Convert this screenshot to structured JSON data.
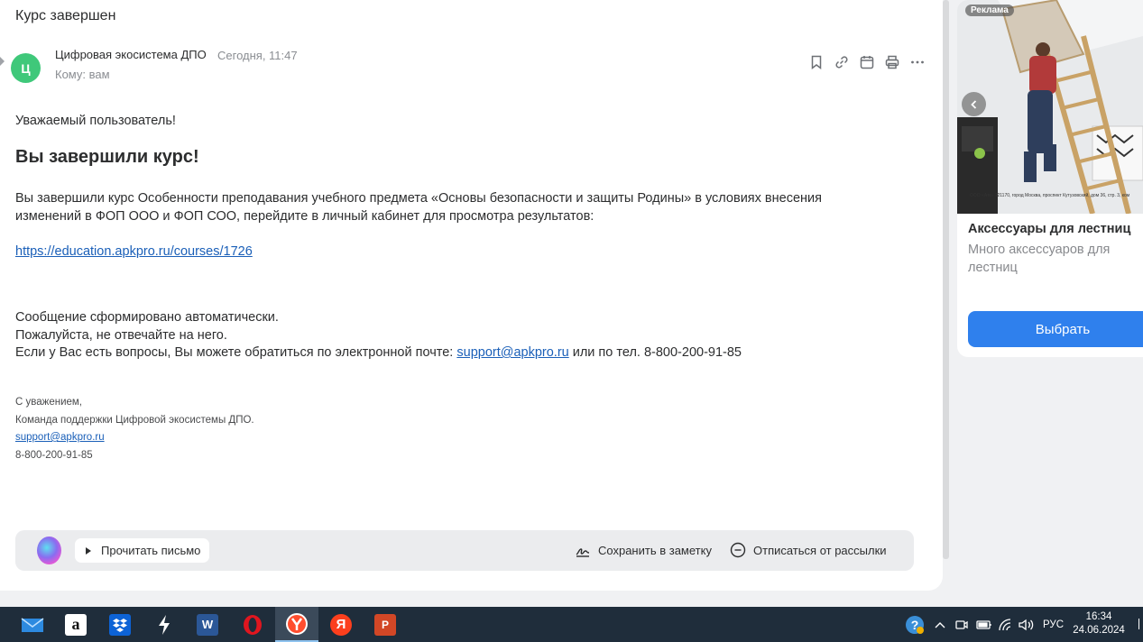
{
  "mail": {
    "subject": "Курс завершен",
    "avatar_letter": "Ц",
    "sender": "Цифровая экосистема ДПО",
    "date": "Сегодня, 11:47",
    "to_label": "Кому:",
    "to_value": "вам",
    "greeting": "Уважаемый пользователь!",
    "headline": "Вы завершили курс!",
    "paragraph": "Вы завершили курс Особенности преподавания учебного предмета «Основы безопасности и защиты Родины» в условиях внесения изменений в ФОП ООО и ФОП СОО, перейдите в личный кабинет для просмотра результатов:",
    "course_link": "https://education.apkpro.ru/courses/1726",
    "auto_line1": "Сообщение сформировано автоматически.",
    "auto_line2": "Пожалуйста, не отвечайте на него.",
    "auto_line3_prefix": "Если у Вас есть вопросы, Вы можете обратиться по электронной почте: ",
    "auto_line3_email": "support@apkpro.ru",
    "auto_line3_suffix": " или по тел. 8-800-200-91-85",
    "sign_line1": "С уважением,",
    "sign_line2": "Команда поддержки Цифровой экосистемы ДПО.",
    "sign_email": "support@apkpro.ru",
    "sign_phone": "8-800-200-91-85",
    "toolbar_icons": [
      "bookmark-icon",
      "link-icon",
      "calendar-icon",
      "print-icon",
      "more-icon"
    ]
  },
  "action_bar": {
    "read_label": "Прочитать письмо",
    "save_note_label": "Сохранить в заметку",
    "unsubscribe_label": "Отписаться от рассылки"
  },
  "ad": {
    "badge": "Реклама",
    "small_print": "ООО «Атк» 121170, город Москва, проспект Кутузовский, дом 36, стр. 3, ком",
    "title": "Аксессуары для лестниц",
    "description": "Много аксессуаров для лестниц",
    "button_label": "Выбрать",
    "accent_color": "#2f80ed"
  },
  "taskbar": {
    "apps": [
      "mail",
      "amazon",
      "dropbox",
      "bolt",
      "word",
      "opera",
      "yandex-browser",
      "yandex",
      "powerpoint"
    ],
    "active_app": "yandex-browser",
    "language": "РУС",
    "time": "16:34",
    "date": "24.06.2024"
  }
}
